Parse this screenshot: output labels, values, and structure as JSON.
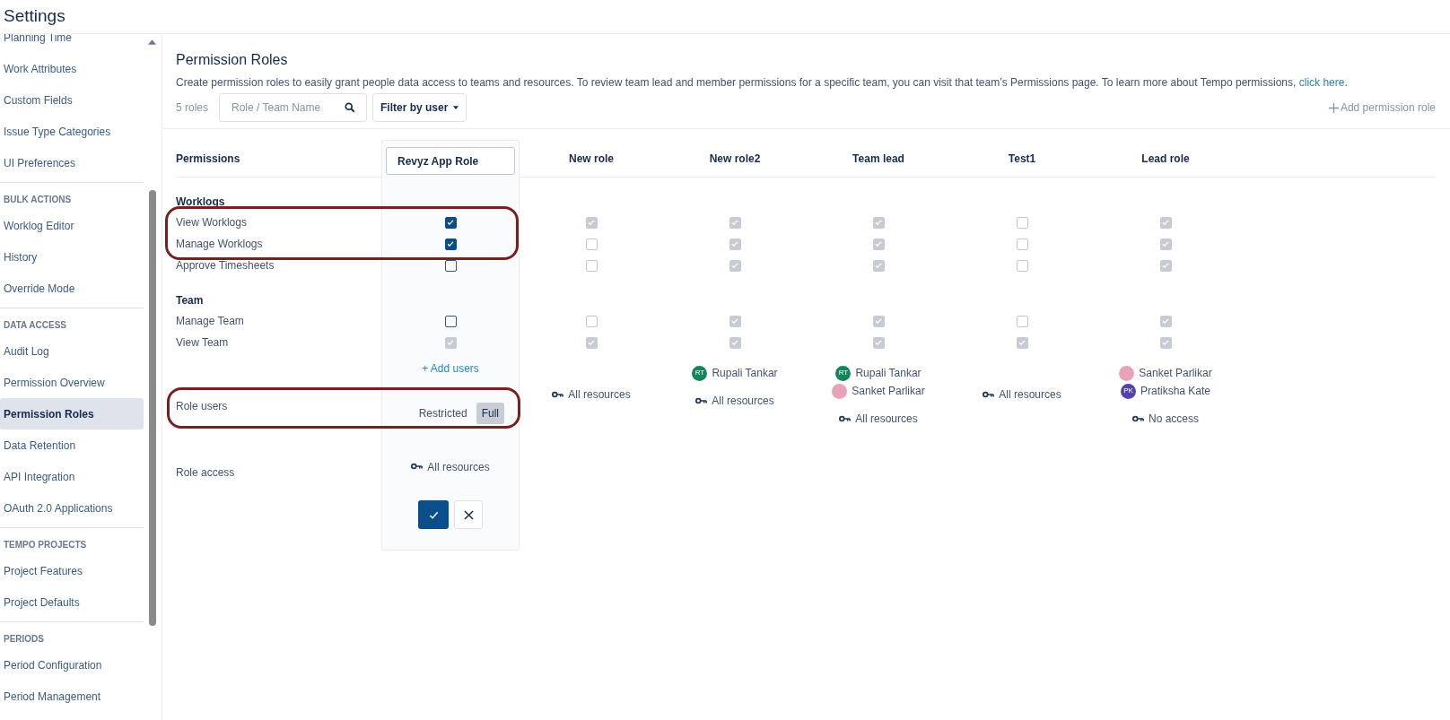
{
  "app_title": "Settings",
  "sidebar": {
    "groups": [
      {
        "items": [
          {
            "label": "Planning Time",
            "selected": false
          },
          {
            "label": "Work Attributes",
            "selected": false
          },
          {
            "label": "Custom Fields",
            "selected": false
          },
          {
            "label": "Issue Type Categories",
            "selected": false
          },
          {
            "label": "UI Preferences",
            "selected": false
          }
        ]
      },
      {
        "heading": "BULK ACTIONS",
        "items": [
          {
            "label": "Worklog Editor",
            "selected": false
          },
          {
            "label": "History",
            "selected": false
          },
          {
            "label": "Override Mode",
            "selected": false
          }
        ]
      },
      {
        "heading": "DATA ACCESS",
        "items": [
          {
            "label": "Audit Log",
            "selected": false
          },
          {
            "label": "Permission Overview",
            "selected": false
          },
          {
            "label": "Permission Roles",
            "selected": true
          },
          {
            "label": "Data Retention",
            "selected": false
          },
          {
            "label": "API Integration",
            "selected": false
          },
          {
            "label": "OAuth 2.0 Applications",
            "selected": false
          }
        ]
      },
      {
        "heading": "TEMPO PROJECTS",
        "items": [
          {
            "label": "Project Features",
            "selected": false
          },
          {
            "label": "Project Defaults",
            "selected": false
          }
        ]
      },
      {
        "heading": "PERIODS",
        "items": [
          {
            "label": "Period Configuration",
            "selected": false
          },
          {
            "label": "Period Management",
            "selected": false
          }
        ]
      }
    ]
  },
  "page": {
    "title": "Permission Roles",
    "description": "Create permission roles to easily grant people data access to teams and resources. To review team lead and member permissions for a specific team, you can visit that team’s Permissions page. To learn more about Tempo permissions, ",
    "description_link": "click here",
    "description_end": ".",
    "role_count": "5 roles",
    "search": {
      "placeholder": "Role / Team Name"
    },
    "filter_button": "Filter by user",
    "add_button": "Add permission role"
  },
  "table": {
    "permissions_heading": "Permissions",
    "editor": {
      "name": "Revyz App Role",
      "add_users": "+ Add users",
      "role_users": [
        {
          "label": "Restricted",
          "selected": false
        },
        {
          "label": "Full",
          "selected": true
        }
      ],
      "access": "All resources"
    },
    "roles": [
      {
        "name": "New role",
        "access": "All resources"
      },
      {
        "name": "New role2",
        "users": [
          {
            "name": "Rupali Tankar",
            "kind": "initials",
            "initials": "RT",
            "color": "#13855a"
          }
        ],
        "access": "All resources"
      },
      {
        "name": "Team lead",
        "users": [
          {
            "name": "Rupali Tankar",
            "kind": "initials",
            "initials": "RT",
            "color": "#13855a"
          },
          {
            "name": "Sanket Parlikar",
            "kind": "photo",
            "color": "#e8a3b8"
          }
        ],
        "access": "All resources"
      },
      {
        "name": "Test1",
        "access": "All resources"
      },
      {
        "name": "Lead role",
        "users": [
          {
            "name": "Sanket Parlikar",
            "kind": "photo",
            "color": "#e8a3b8"
          },
          {
            "name": "Pratiksha Kate",
            "kind": "initials",
            "initials": "PK",
            "color": "#5243aa"
          }
        ],
        "access": "No access"
      }
    ],
    "rows": [
      {
        "kind": "section",
        "label": "Worklogs"
      },
      {
        "kind": "permission",
        "label": "View Worklogs",
        "outlined": true,
        "editor": {
          "checked": true,
          "disabled": false
        },
        "roles": [
          {
            "checked": true,
            "disabled": true
          },
          {
            "checked": true,
            "disabled": true
          },
          {
            "checked": true,
            "disabled": true
          },
          {
            "checked": false,
            "disabled": true
          },
          {
            "checked": true,
            "disabled": true
          }
        ]
      },
      {
        "kind": "permission",
        "label": "Manage Worklogs",
        "outlined": true,
        "editor": {
          "checked": true,
          "disabled": false
        },
        "roles": [
          {
            "checked": false,
            "disabled": true
          },
          {
            "checked": true,
            "disabled": true
          },
          {
            "checked": true,
            "disabled": true
          },
          {
            "checked": false,
            "disabled": true
          },
          {
            "checked": true,
            "disabled": true
          }
        ]
      },
      {
        "kind": "permission",
        "label": "Approve Timesheets",
        "outlined": false,
        "editor": {
          "checked": false,
          "disabled": false
        },
        "roles": [
          {
            "checked": false,
            "disabled": true
          },
          {
            "checked": true,
            "disabled": true
          },
          {
            "checked": true,
            "disabled": true
          },
          {
            "checked": false,
            "disabled": true
          },
          {
            "checked": true,
            "disabled": true
          }
        ]
      },
      {
        "kind": "section",
        "label": "Team"
      },
      {
        "kind": "permission",
        "label": "Manage Team",
        "outlined": false,
        "editor": {
          "checked": false,
          "disabled": false
        },
        "roles": [
          {
            "checked": false,
            "disabled": true
          },
          {
            "checked": true,
            "disabled": true
          },
          {
            "checked": true,
            "disabled": true
          },
          {
            "checked": false,
            "disabled": true
          },
          {
            "checked": true,
            "disabled": true
          }
        ]
      },
      {
        "kind": "permission",
        "label": "View Team",
        "outlined": false,
        "editor": {
          "checked": true,
          "disabled": true
        },
        "roles": [
          {
            "checked": true,
            "disabled": true
          },
          {
            "checked": true,
            "disabled": true
          },
          {
            "checked": true,
            "disabled": true
          },
          {
            "checked": true,
            "disabled": true
          },
          {
            "checked": true,
            "disabled": true
          }
        ]
      }
    ],
    "role_users_label": "Role users",
    "role_users_outlined": true,
    "role_access_label": "Role access"
  }
}
